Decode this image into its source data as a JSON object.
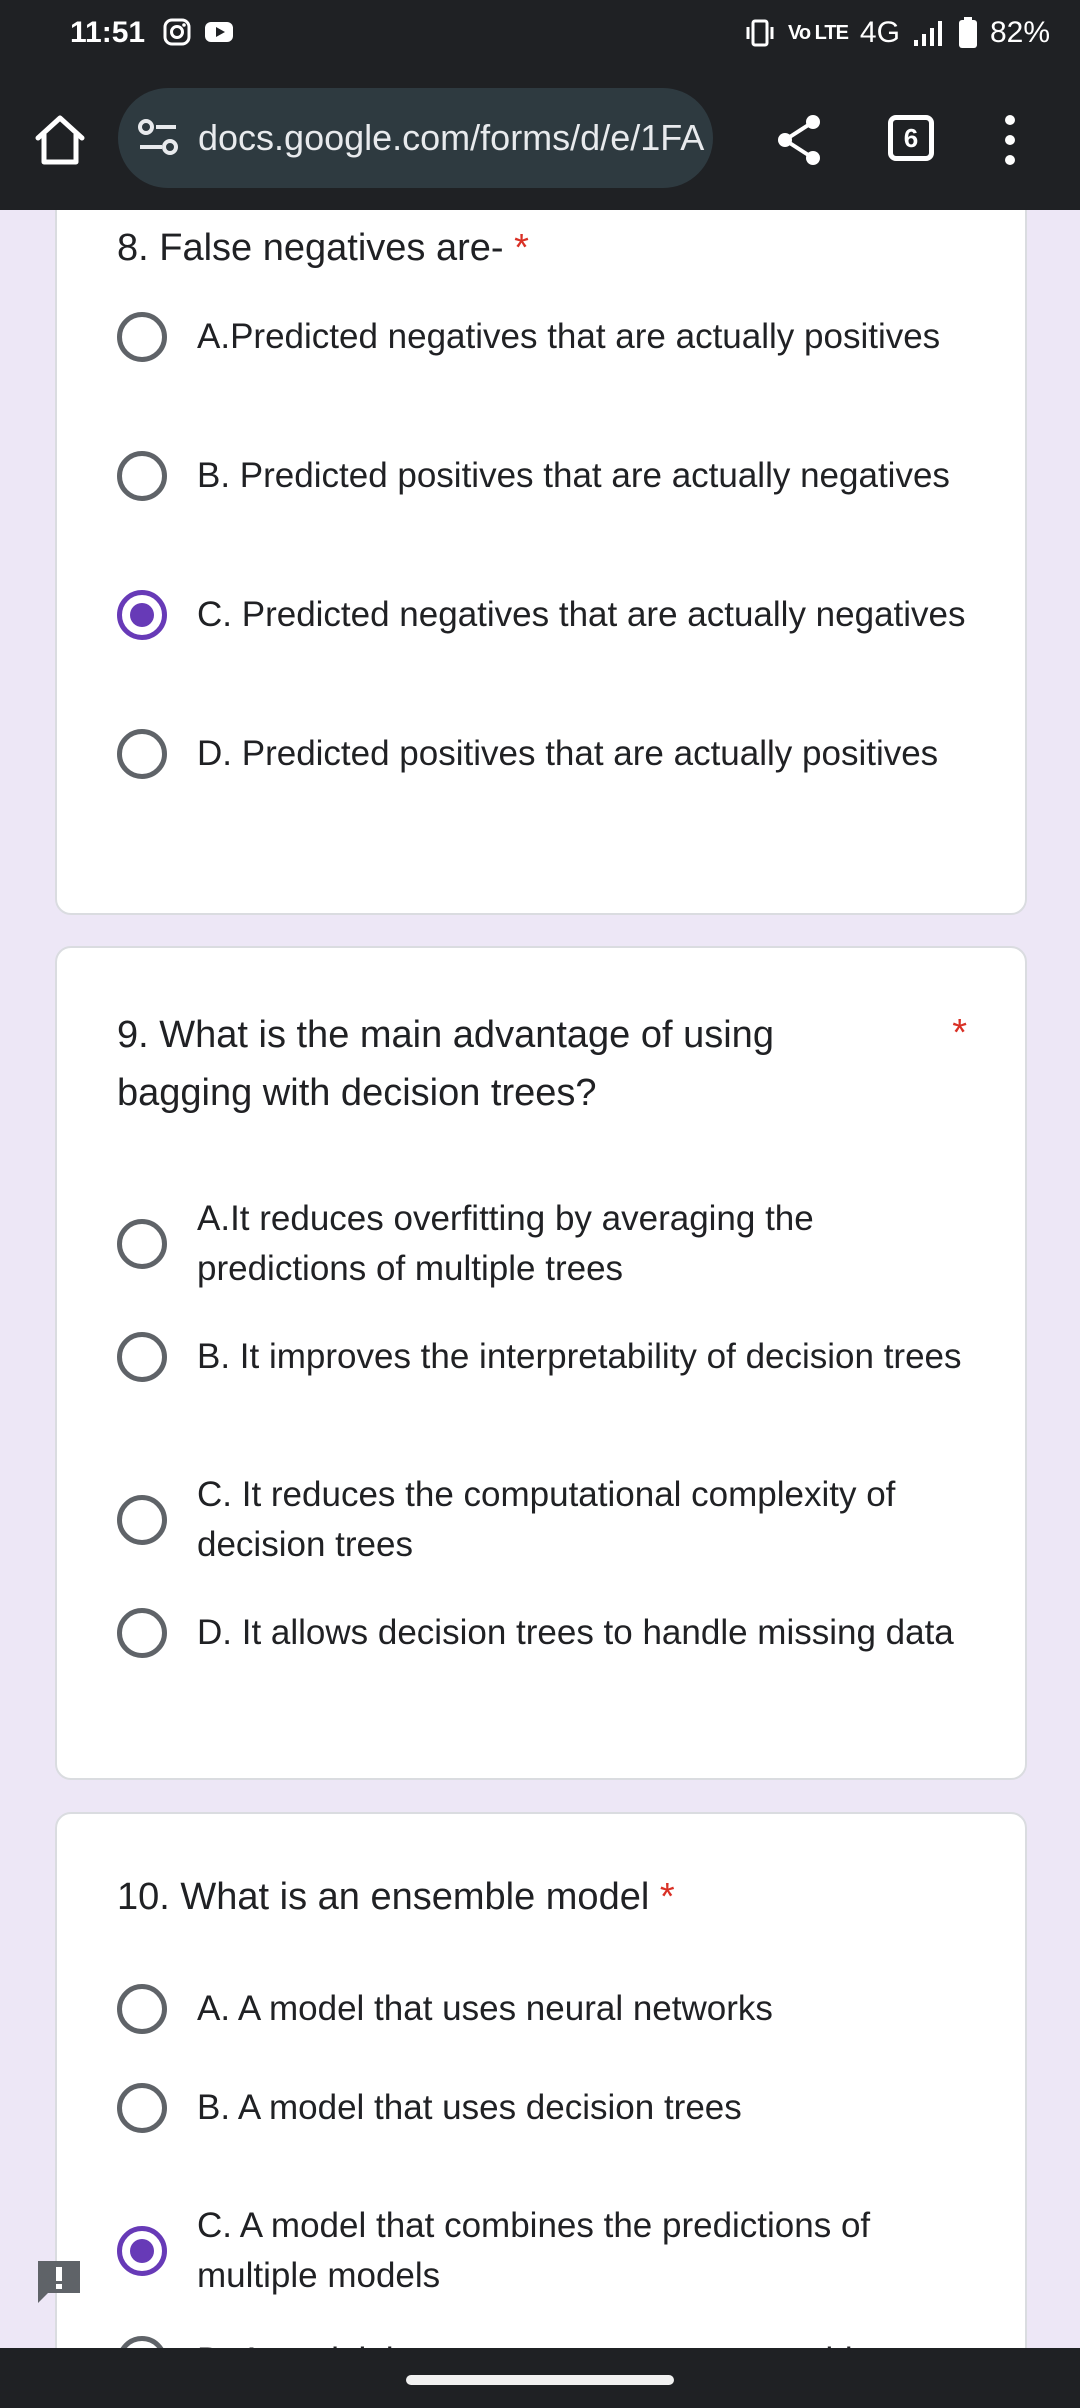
{
  "status_bar": {
    "time": "11:51",
    "network_label": "4G",
    "volte_label": "Vo LTE",
    "battery": "82%",
    "icons": [
      "instagram-icon",
      "youtube-icon",
      "vibrate-icon",
      "signal-icon",
      "battery-icon"
    ]
  },
  "browser": {
    "url": "docs.google.com/forms/d/e/1FA",
    "tab_count": "6"
  },
  "colors": {
    "accent": "#673ab7",
    "required": "#d93025",
    "page_bg": "#ede7f6",
    "bar_bg": "#1f2124"
  },
  "questions": [
    {
      "title": "8. False negatives are-",
      "required_mark": "*",
      "options": [
        {
          "label": "A.Predicted negatives that are actually positives",
          "checked": false
        },
        {
          "label": "B. Predicted positives that are actually negatives",
          "checked": false
        },
        {
          "label": "C. Predicted negatives that are actually negatives",
          "checked": true
        },
        {
          "label": "D. Predicted positives that are actually positives",
          "checked": false
        }
      ]
    },
    {
      "title": "9. What is the main advantage of using bagging with decision trees?",
      "required_mark": "*",
      "options": [
        {
          "label": "A.It reduces overfitting by averaging the predictions of multiple trees",
          "checked": false
        },
        {
          "label": "B. It improves the interpretability of decision trees",
          "checked": false
        },
        {
          "label": "C. It reduces the computational complexity of decision trees",
          "checked": false
        },
        {
          "label": "D. It allows decision trees to handle missing data",
          "checked": false
        }
      ]
    },
    {
      "title": "10. What is an ensemble model",
      "required_mark": "*",
      "options": [
        {
          "label": "A. A model that uses neural networks",
          "checked": false
        },
        {
          "label": "B. A model that uses decision trees",
          "checked": false
        },
        {
          "label": "C. A model that combines the predictions of multiple models",
          "checked": true
        },
        {
          "label": "D. A model that uses support vector machines",
          "checked": false
        }
      ]
    }
  ]
}
